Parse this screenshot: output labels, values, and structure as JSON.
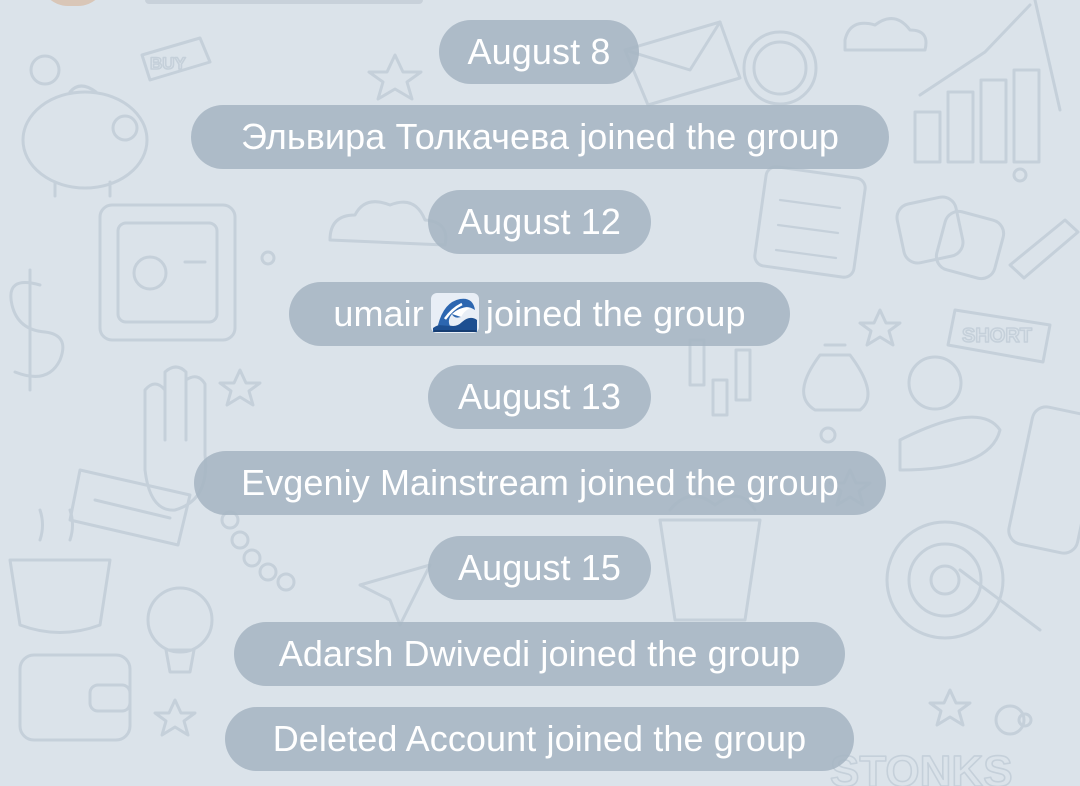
{
  "theme": {
    "background": "#dbe3ea",
    "pill_background": "#a6b5c3",
    "pill_text": "#ffffff"
  },
  "wallpaper": {
    "labels": [
      "BUY",
      "SHORT",
      "STONKS"
    ]
  },
  "messages": [
    {
      "type": "date",
      "text": "August 8"
    },
    {
      "type": "service",
      "text": "Эльвира Толкачева joined the group"
    },
    {
      "type": "date",
      "text": "August 12"
    },
    {
      "type": "service",
      "name": "umair",
      "icon": "wave-icon",
      "suffix": "joined the group"
    },
    {
      "type": "date",
      "text": "August 13"
    },
    {
      "type": "service",
      "text": "Evgeniy Mainstream joined the group"
    },
    {
      "type": "date",
      "text": "August 15"
    },
    {
      "type": "service",
      "text": "Adarsh Dwivedi joined the group"
    },
    {
      "type": "service",
      "text": "Deleted Account joined the group"
    }
  ]
}
